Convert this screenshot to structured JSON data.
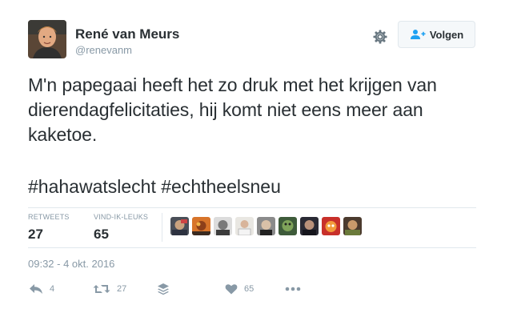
{
  "author": {
    "name": "René van Meurs",
    "handle": "@renevanm"
  },
  "follow_button": {
    "label": "Volgen"
  },
  "tweet": {
    "text": "M'n papegaai heeft het zo druk met het krijgen van dierendagfelicitaties, hij komt niet eens meer aan kaketoe.",
    "hashtags": [
      "#hahawatslecht",
      "#echtheelsneu"
    ]
  },
  "stats": {
    "retweets_label": "RETWEETS",
    "retweets_count": "27",
    "likes_label": "VIND-IK-LEUKS",
    "likes_count": "65"
  },
  "timestamp": "09:32 - 4 okt. 2016",
  "actions": {
    "reply_count": "4",
    "retweet_count": "27",
    "like_count": "65"
  },
  "icons": {
    "settings": "gear-icon",
    "follow": "person-plus-icon",
    "reply": "reply-icon",
    "retweet": "retweet-icon",
    "buffer": "layers-icon",
    "like": "heart-icon",
    "more": "more-icon"
  },
  "colors": {
    "text": "#292f33",
    "muted": "#8899a6",
    "link_blue": "#1da1f2",
    "border": "#e1e8ed"
  }
}
